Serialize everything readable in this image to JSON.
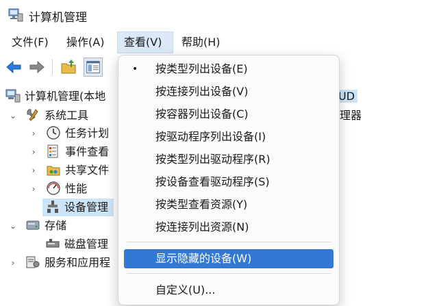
{
  "window": {
    "title": "计算机管理"
  },
  "menubar": {
    "items": [
      {
        "label": "文件(F)"
      },
      {
        "label": "操作(A)"
      },
      {
        "label": "查看(V)"
      },
      {
        "label": "帮助(H)"
      }
    ]
  },
  "tree": {
    "root": "计算机管理(本地",
    "system_tools": "系统工具",
    "task_scheduler": "任务计划",
    "event_viewer": "事件查看",
    "shared_folders": "共享文件",
    "performance": "性能",
    "device_manager": "设备管理",
    "storage": "存储",
    "disk_management": "磁盘管理",
    "services_apps": "服务和应用程"
  },
  "right_pane": {
    "line1": "UD",
    "line2": "理器"
  },
  "view_menu": {
    "items": [
      {
        "label": "按类型列出设备(E)",
        "checked": true
      },
      {
        "label": "按连接列出设备(V)"
      },
      {
        "label": "按容器列出设备(C)"
      },
      {
        "label": "按驱动程序列出设备(I)"
      },
      {
        "label": "按类型列出驱动程序(R)"
      },
      {
        "label": "按设备查看驱动程序(S)"
      },
      {
        "label": "按类型查看资源(Y)"
      },
      {
        "label": "按连接列出资源(N)"
      },
      {
        "label": "显示隐藏的设备(W)",
        "highlighted": true
      },
      {
        "label": "自定义(U)..."
      }
    ],
    "bullet": "•"
  },
  "colors": {
    "highlight": "#3379d4",
    "selection": "#cce4f7",
    "active_menu": "#dbe8f8"
  }
}
